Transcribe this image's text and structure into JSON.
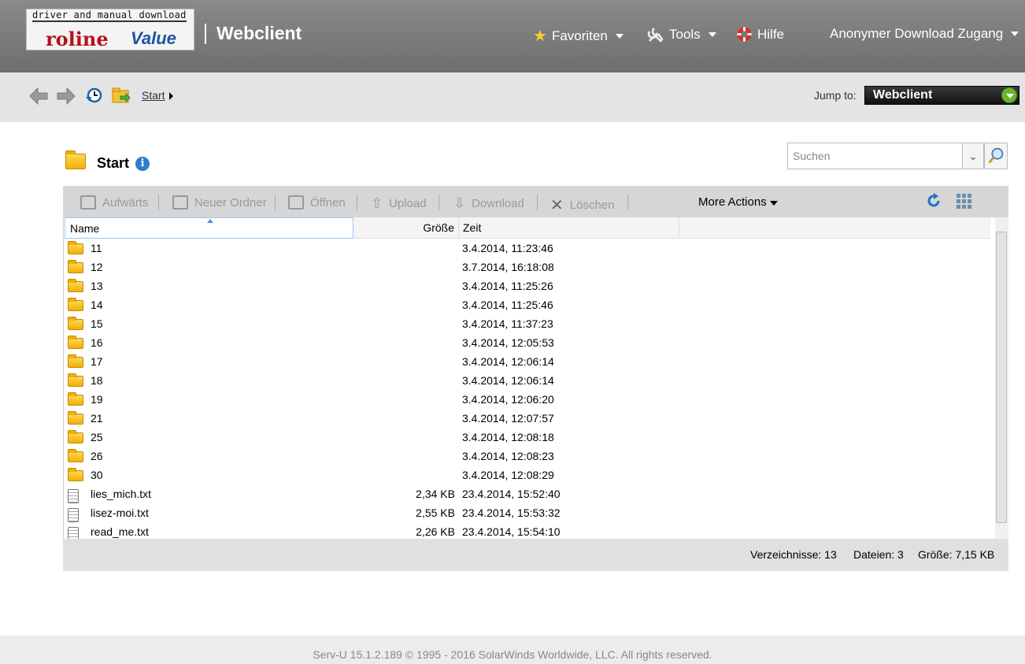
{
  "logo": {
    "line1": "driver and manual download",
    "brand": "roline",
    "value": "Value"
  },
  "header": {
    "title": "Webclient",
    "favorites": "Favoriten",
    "tools": "Tools",
    "help": "Hilfe",
    "user": "Anonymer Download Zugang"
  },
  "breadcrumb": {
    "start": "Start"
  },
  "jump": {
    "label": "Jump to:",
    "value": "Webclient"
  },
  "page": {
    "title": "Start"
  },
  "search": {
    "placeholder": "Suchen"
  },
  "toolbar": {
    "up": "Aufwärts",
    "new_folder": "Neuer Ordner",
    "open": "Öffnen",
    "upload": "Upload",
    "download": "Download",
    "delete": "Löschen",
    "more": "More Actions"
  },
  "columns": {
    "name": "Name",
    "size": "Größe",
    "time": "Zeit"
  },
  "rows": [
    {
      "type": "folder",
      "name": "11",
      "size": "",
      "time": "3.4.2014, 11:23:46"
    },
    {
      "type": "folder",
      "name": "12",
      "size": "",
      "time": "3.7.2014, 16:18:08"
    },
    {
      "type": "folder",
      "name": "13",
      "size": "",
      "time": "3.4.2014, 11:25:26"
    },
    {
      "type": "folder",
      "name": "14",
      "size": "",
      "time": "3.4.2014, 11:25:46"
    },
    {
      "type": "folder",
      "name": "15",
      "size": "",
      "time": "3.4.2014, 11:37:23"
    },
    {
      "type": "folder",
      "name": "16",
      "size": "",
      "time": "3.4.2014, 12:05:53"
    },
    {
      "type": "folder",
      "name": "17",
      "size": "",
      "time": "3.4.2014, 12:06:14"
    },
    {
      "type": "folder",
      "name": "18",
      "size": "",
      "time": "3.4.2014, 12:06:14"
    },
    {
      "type": "folder",
      "name": "19",
      "size": "",
      "time": "3.4.2014, 12:06:20"
    },
    {
      "type": "folder",
      "name": "21",
      "size": "",
      "time": "3.4.2014, 12:07:57"
    },
    {
      "type": "folder",
      "name": "25",
      "size": "",
      "time": "3.4.2014, 12:08:18"
    },
    {
      "type": "folder",
      "name": "26",
      "size": "",
      "time": "3.4.2014, 12:08:23"
    },
    {
      "type": "folder",
      "name": "30",
      "size": "",
      "time": "3.4.2014, 12:08:29"
    },
    {
      "type": "file",
      "name": "lies_mich.txt",
      "size": "2,34 KB",
      "time": "23.4.2014, 15:52:40"
    },
    {
      "type": "file",
      "name": "lisez-moi.txt",
      "size": "2,55 KB",
      "time": "23.4.2014, 15:53:32"
    },
    {
      "type": "file",
      "name": "read_me.txt",
      "size": "2,26 KB",
      "time": "23.4.2014, 15:54:10"
    }
  ],
  "status": {
    "dirs": "Verzeichnisse: 13",
    "files": "Dateien: 3",
    "size": "Größe: 7,15 KB"
  },
  "footer": "Serv-U 15.1.2.189 © 1995 - 2016 SolarWinds Worldwide, LLC. All rights reserved."
}
